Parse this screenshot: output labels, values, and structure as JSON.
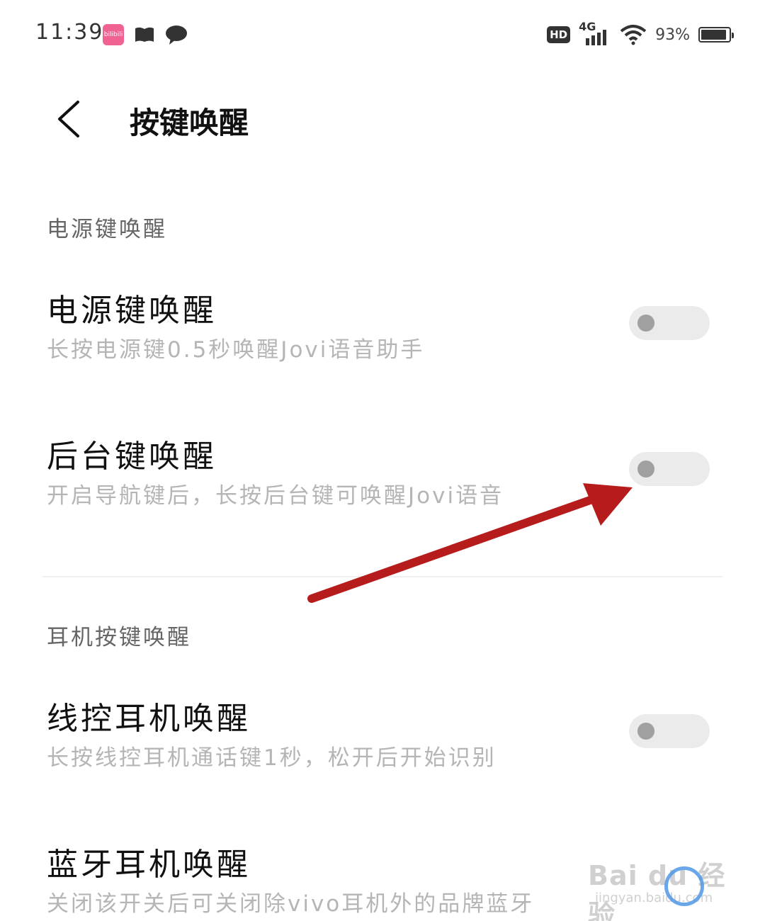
{
  "status_bar": {
    "time": "11:39",
    "hd_label": "HD",
    "network_label": "4G",
    "battery_text": "93%",
    "battery_level_percent": 93,
    "notification_icons": [
      "bilibili-app-icon",
      "book-icon",
      "chat-icon"
    ],
    "bilibili_label": "bilibili"
  },
  "header": {
    "title": "按键唤醒",
    "back_icon": "chevron-left-icon"
  },
  "sections": [
    {
      "title": "电源键唤醒",
      "items": [
        {
          "title": "电源键唤醒",
          "description": "长按电源键0.5秒唤醒Jovi语音助手",
          "enabled": false
        },
        {
          "title": "后台键唤醒",
          "description": "开启导航键后，长按后台键可唤醒Jovi语音",
          "enabled": false
        }
      ]
    },
    {
      "title": "耳机按键唤醒",
      "items": [
        {
          "title": "线控耳机唤醒",
          "description": "长按线控耳机通话键1秒，松开后开始识别",
          "enabled": false
        },
        {
          "title": "蓝牙耳机唤醒",
          "description": "关闭该开关后可关闭除vivo耳机外的品牌蓝牙",
          "enabled": false
        }
      ]
    }
  ],
  "watermark": {
    "brand": "Bai du 经验",
    "url": "jingyan.baidu.com"
  },
  "colors": {
    "annotation_arrow": "#b71c1c",
    "toggle_off_track": "#ebebeb",
    "toggle_off_knob": "#a0a0a0",
    "description_text": "#b5b5b5"
  }
}
